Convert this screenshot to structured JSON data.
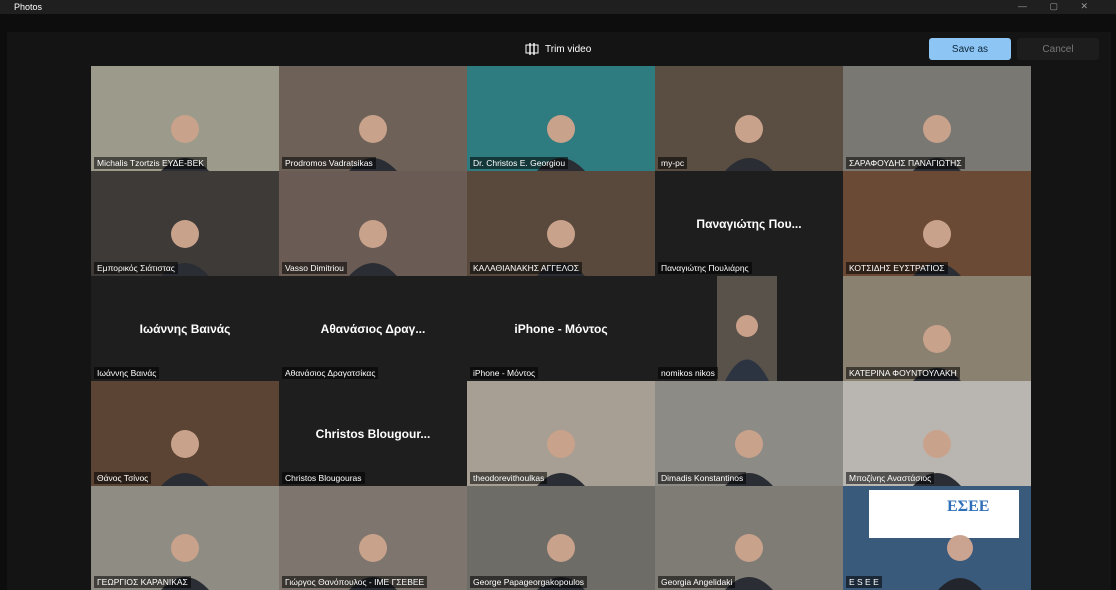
{
  "app": {
    "title": "Photos"
  },
  "toolbar": {
    "trim_label": "Trim video",
    "save_label": "Save as",
    "cancel_label": "Cancel"
  },
  "colors": {
    "save_button": "#8dc6f5",
    "background": "#0d0d0d"
  },
  "tiles": [
    {
      "label": "Michalis Tzortzis ΕΥΔΕ-ΒΕΚ",
      "bg": "#9c9a8a"
    },
    {
      "label": "Prodromos Vadratsikas",
      "bg": "#6e6258"
    },
    {
      "label": "Dr. Christos E. Georgiou",
      "bg": "#2e7c7f"
    },
    {
      "label": "my-pc",
      "bg": "#5a4d42"
    },
    {
      "label": "ΣΑΡΑΦΟΥΔΗΣ ΠΑΝΑΓΙΩΤΗΣ",
      "bg": "#7a7872"
    },
    {
      "label": "Εμπορικός Σιάτιστας",
      "bg": "#3e3a38"
    },
    {
      "label": "Vasso Dimitriou",
      "bg": "#6a5c55"
    },
    {
      "label": "ΚΑΛΑΘΙΑΝΑΚΗΣ ΑΓΓΕΛΟΣ",
      "bg": "#58493c"
    },
    {
      "label": "Παναγιώτης Πουλιάρης",
      "center": "Παναγιώτης Που...",
      "bg": "#1e1e1e"
    },
    {
      "label": "ΚΟΤΣΙΔΗΣ ΕΥΣΤΡΑΤΙΟΣ",
      "bg": "#6b4a35"
    },
    {
      "label": "Ιωάννης Βαινάς",
      "center": "Ιωάννης Βαινάς",
      "bg": "#1e1e1e"
    },
    {
      "label": "Αθανάσιος Δραγατσίκας",
      "center": "Αθανάσιος Δραγ...",
      "bg": "#1e1e1e"
    },
    {
      "label": "iPhone - Μόντος",
      "center": "iPhone - Μόντος",
      "bg": "#1e1e1e"
    },
    {
      "label": "nomikos nikos",
      "bg": "#1e1e1e"
    },
    {
      "label": "ΚΑΤΕΡΙΝΑ ΦΟΥΝΤΟΥΛΑΚΗ",
      "bg": "#8b8170"
    },
    {
      "label": "Θάνος Τσίνος",
      "bg": "#5b4433"
    },
    {
      "label": "Christos Blougouras",
      "center": "Christos Blougour...",
      "bg": "#1e1e1e"
    },
    {
      "label": "theodorevithoulkas",
      "bg": "#a79f93"
    },
    {
      "label": "Dimadis Konstantinos",
      "bg": "#8c8b86"
    },
    {
      "label": "Μποζίνης Αναστάσιος",
      "bg": "#b9b6b1"
    },
    {
      "label": "ΓΕΩΡΓΙΟΣ ΚΑΡΑΝΙΚΑΣ",
      "bg": "#8f8c83"
    },
    {
      "label": "Γιώργος Θανόπουλος - ΙΜΕ ΓΣΕΒΕΕ",
      "bg": "#7d756e"
    },
    {
      "label": "George Papageorgakopoulos",
      "bg": "#6e6c66"
    },
    {
      "label": "Georgia Angelidaki",
      "bg": "#7f7c76"
    },
    {
      "label": "E S E E",
      "bg": "#3a5a7c",
      "logo": "ΕΣΕΕ"
    }
  ]
}
